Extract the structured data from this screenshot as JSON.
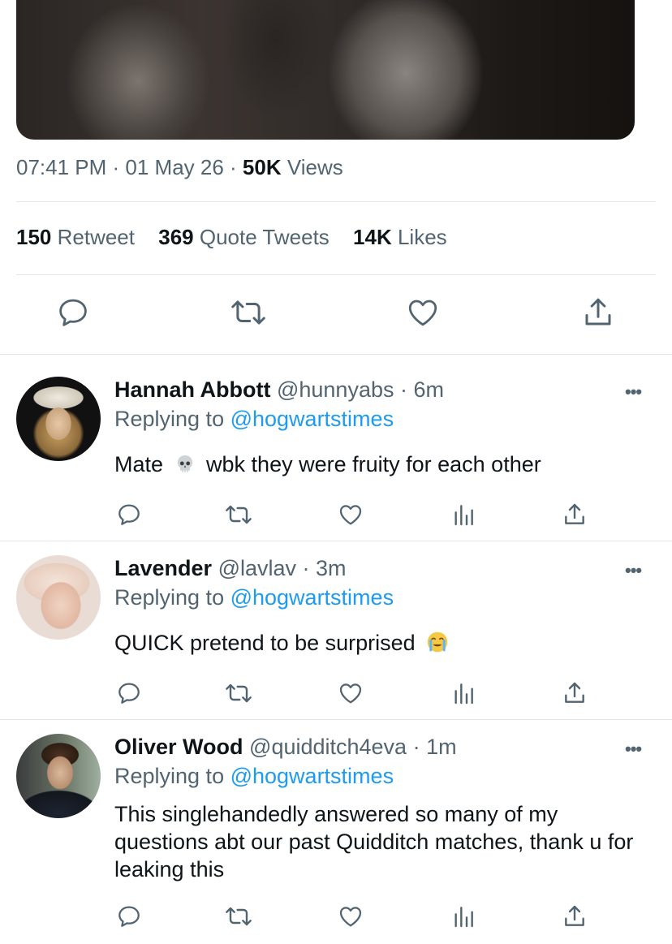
{
  "tweet": {
    "time": "07:41 PM",
    "sep1": " · ",
    "date": "01 May 26",
    "sep2": " · ",
    "views_count": "50K",
    "views_label": " Views",
    "stats": [
      {
        "count": "150",
        "label": " Retweet"
      },
      {
        "count": "369",
        "label": " Quote Tweets"
      },
      {
        "count": "14K",
        "label": " Likes"
      }
    ],
    "actions": [
      "reply-icon",
      "retweet-icon",
      "like-icon",
      "share-icon"
    ]
  },
  "replies": [
    {
      "name": "Hannah Abbott",
      "handle": " @hunnyabs · 6m",
      "replying_prefix": "Replying to ",
      "replying_handle": "@hogwartstimes",
      "text_before": "Mate ",
      "emoji": "skull-emoji",
      "text_after": " wbk they were fruity for each other",
      "more": "•••"
    },
    {
      "name": "Lavender",
      "handle": " @lavlav · 3m",
      "replying_prefix": "Replying to ",
      "replying_handle": "@hogwartstimes",
      "text_before": "QUICK pretend to be surprised ",
      "emoji": "crying-face-emoji",
      "text_after": "",
      "more": "•••"
    },
    {
      "name": "Oliver Wood",
      "handle": " @quidditch4eva · 1m",
      "replying_prefix": "Replying to ",
      "replying_handle": "@hogwartstimes",
      "text_before": "This singlehandedly answered so many of my questions abt our past Quidditch matches, thank u for leaking this",
      "emoji": "",
      "text_after": "",
      "more": "•••"
    }
  ],
  "row_actions": [
    "reply-icon",
    "retweet-icon",
    "like-icon",
    "analytics-icon",
    "share-icon"
  ],
  "colors": {
    "link": "#1d9bf0",
    "secondary": "#536471",
    "primary": "#0f1419"
  }
}
